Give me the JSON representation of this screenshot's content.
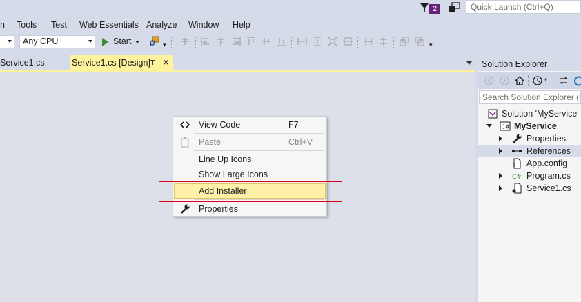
{
  "titlebar": {
    "notification_count": "2",
    "quick_launch_placeholder": "Quick Launch (Ctrl+Q)"
  },
  "menubar": {
    "items": [
      "n",
      "Tools",
      "Test",
      "Web Essentials",
      "Analyze",
      "Window",
      "Help"
    ]
  },
  "toolbar": {
    "config_value": "",
    "platform_value": "Any CPU",
    "start_label": "Start"
  },
  "doc_tabs": {
    "tab1": "Service1.cs",
    "tab2": "Service1.cs [Design]"
  },
  "context_menu": {
    "items": [
      {
        "label": "View Code",
        "shortcut": "F7",
        "icon": "code-icon",
        "enabled": true
      },
      {
        "label": "Paste",
        "shortcut": "Ctrl+V",
        "icon": "paste-icon",
        "enabled": false
      },
      {
        "label": "Line Up Icons",
        "shortcut": "",
        "icon": "",
        "enabled": true
      },
      {
        "label": "Show Large Icons",
        "shortcut": "",
        "icon": "",
        "enabled": true
      },
      {
        "label": "Add Installer",
        "shortcut": "",
        "icon": "",
        "enabled": true,
        "highlighted": true
      },
      {
        "label": "Properties",
        "shortcut": "",
        "icon": "wrench-icon",
        "enabled": true
      }
    ]
  },
  "solution_explorer": {
    "title": "Solution Explorer",
    "search_placeholder": "Search Solution Explorer (C",
    "tree": [
      {
        "label": "Solution 'MyService' (",
        "icon": "solution-icon",
        "indent": 0,
        "expander": "none"
      },
      {
        "label": "MyService",
        "icon": "csharp-project-icon",
        "indent": 1,
        "expander": "open",
        "bold": true
      },
      {
        "label": "Properties",
        "icon": "wrench-icon",
        "indent": 2,
        "expander": "closed"
      },
      {
        "label": "References",
        "icon": "references-icon",
        "indent": 2,
        "expander": "closed",
        "selected": true
      },
      {
        "label": "App.config",
        "icon": "config-file-icon",
        "indent": 2,
        "expander": "none"
      },
      {
        "label": "Program.cs",
        "icon": "csharp-file-icon",
        "indent": 2,
        "expander": "closed"
      },
      {
        "label": "Service1.cs",
        "icon": "service-file-icon",
        "indent": 2,
        "expander": "closed"
      }
    ]
  },
  "colors": {
    "ide_background": "#d6dbe9",
    "design_surface": "#dde0e8",
    "active_tab": "#fff29d",
    "highlight_box": "#d9001b",
    "menu_hover": "#fff1a8"
  }
}
